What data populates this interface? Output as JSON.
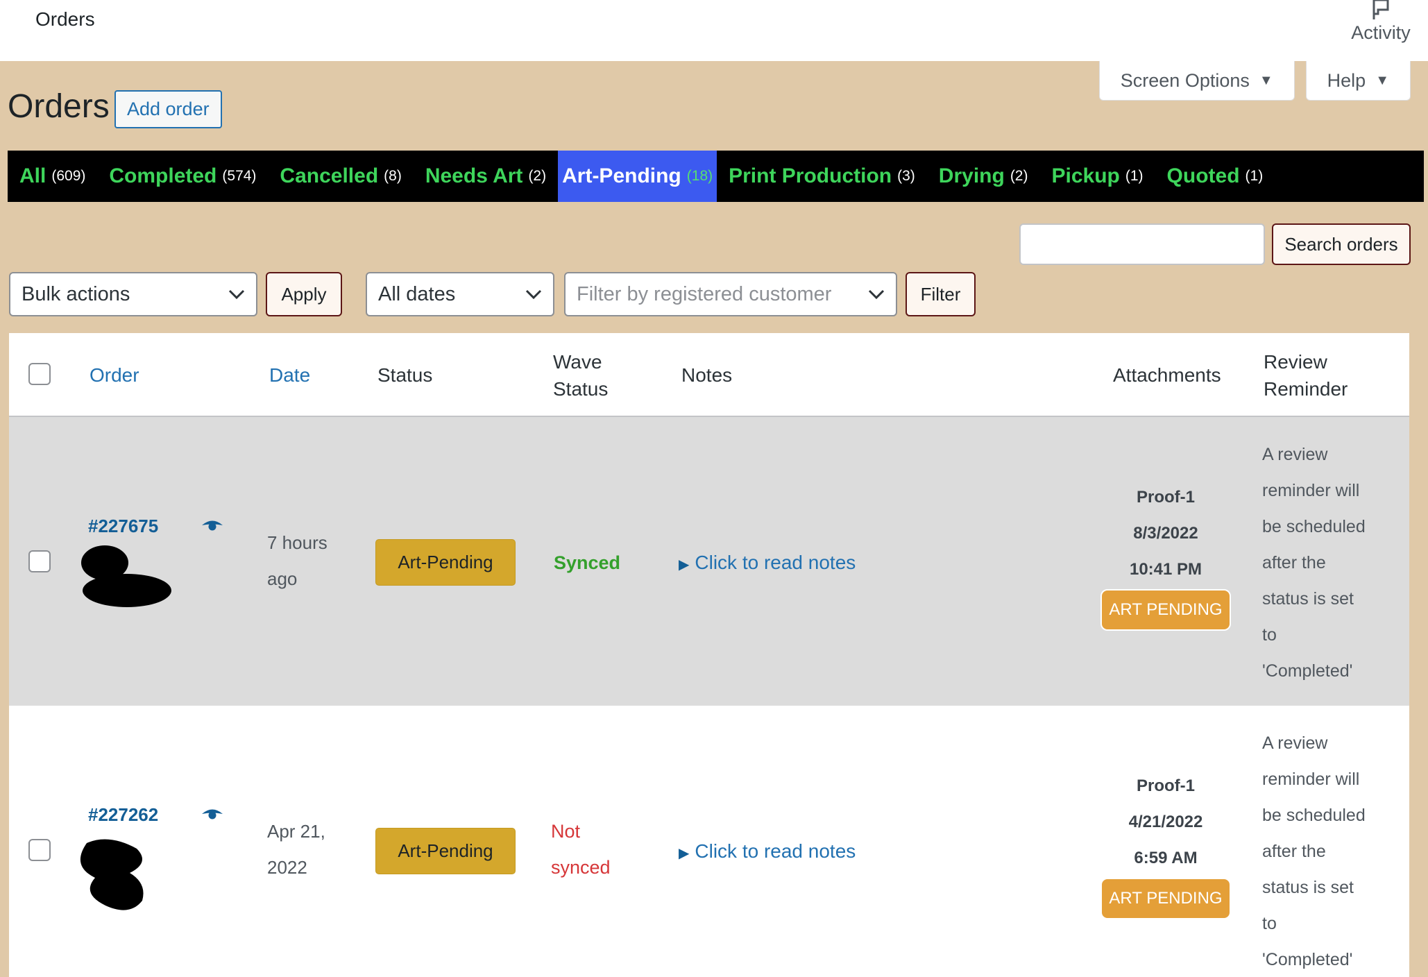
{
  "topbar": {
    "breadcrumb": "Orders",
    "activity_label": "Activity"
  },
  "screen_meta": {
    "screen_options": "Screen Options",
    "help": "Help"
  },
  "heading": {
    "title": "Orders",
    "add_order": "Add order"
  },
  "status_tabs": [
    {
      "label": "All",
      "count": "(609)"
    },
    {
      "label": "Completed",
      "count": "(574)"
    },
    {
      "label": "Cancelled",
      "count": "(8)"
    },
    {
      "label": "Needs Art",
      "count": "(2)"
    },
    {
      "label": "Art-Pending",
      "count": "(18)"
    },
    {
      "label": "Print Production",
      "count": "(3)"
    },
    {
      "label": "Drying",
      "count": "(2)"
    },
    {
      "label": "Pickup",
      "count": "(1)"
    },
    {
      "label": "Quoted",
      "count": "(1)"
    }
  ],
  "active_tab": "Art-Pending",
  "search": {
    "value": "",
    "button": "Search orders"
  },
  "filters": {
    "bulk_actions": "Bulk actions",
    "apply": "Apply",
    "dates": "All dates",
    "customer_placeholder": "Filter by registered customer",
    "filter": "Filter"
  },
  "columns": {
    "order": "Order",
    "date": "Date",
    "status": "Status",
    "wave_line1": "Wave",
    "wave_line2": "Status",
    "notes": "Notes",
    "attachments": "Attachments",
    "review_line1": "Review",
    "review_line2": "Reminder"
  },
  "rows": [
    {
      "order": "#227675",
      "date_line1": "7 hours",
      "date_line2": "ago",
      "status": "Art-Pending",
      "wave_line1": "Synced",
      "wave_line2": "",
      "notes": "Click to read notes",
      "attach_name": "Proof-1",
      "attach_date": "8/3/2022",
      "attach_time": "10:41 PM",
      "attach_badge": "ART PENDING",
      "review": [
        "A review",
        "reminder will",
        "be scheduled",
        "after the",
        "status is set",
        "to",
        "'Completed'"
      ]
    },
    {
      "order": "#227262",
      "date_line1": "Apr 21,",
      "date_line2": "2022",
      "status": "Art-Pending",
      "wave_line1": "Not",
      "wave_line2": "synced",
      "notes": "Click to read notes",
      "attach_name": "Proof-1",
      "attach_date": "4/21/2022",
      "attach_time": "6:59 AM",
      "attach_badge": "ART PENDING",
      "review": [
        "A review",
        "reminder will",
        "be scheduled",
        "after the",
        "status is set",
        "to",
        "'Completed'"
      ]
    }
  ],
  "colors": {
    "page_bg": "#e0c9a8",
    "status_bar_bg": "#000000",
    "status_tab_text": "#3ed55b",
    "active_tab_bg": "#3c5af0",
    "pill_bg": "#d4a72c",
    "badge_bg": "#e49f38",
    "synced": "#34a02c",
    "not_synced": "#d63638",
    "link": "#2271b1"
  },
  "icons": {
    "activity": "flag-icon",
    "view": "eye-icon",
    "select": "chevron-down-icon",
    "notes": "triangle-right-icon"
  }
}
